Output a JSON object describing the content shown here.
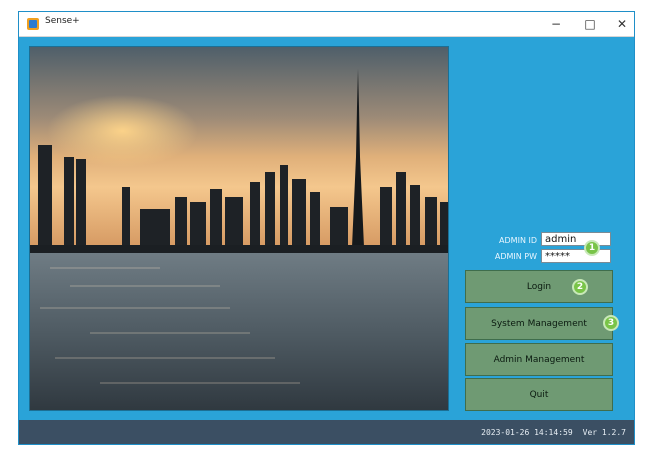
{
  "window": {
    "title": "Sense+",
    "controls": {
      "minimize": "−",
      "maximize": "□",
      "close": "✕"
    }
  },
  "login": {
    "admin_id_label": "ADMIN ID",
    "admin_id_value": "admin",
    "admin_pw_label": "ADMIN PW",
    "admin_pw_value": "*****"
  },
  "buttons": {
    "login": "Login",
    "system_management": "System Management",
    "admin_management": "Admin Management",
    "quit": "Quit"
  },
  "badges": {
    "one": "1",
    "two": "2",
    "three": "3"
  },
  "status": {
    "datetime": "2023-01-26 14:14:59",
    "version": "Ver 1.2.7"
  },
  "colors": {
    "window_bg": "#2aa3d8",
    "button_bg": "#6f9a73",
    "statusbar_bg": "#3b4f63",
    "badge": "#79c448"
  },
  "image": {
    "subject": "city-skyline-sunset-over-water"
  }
}
